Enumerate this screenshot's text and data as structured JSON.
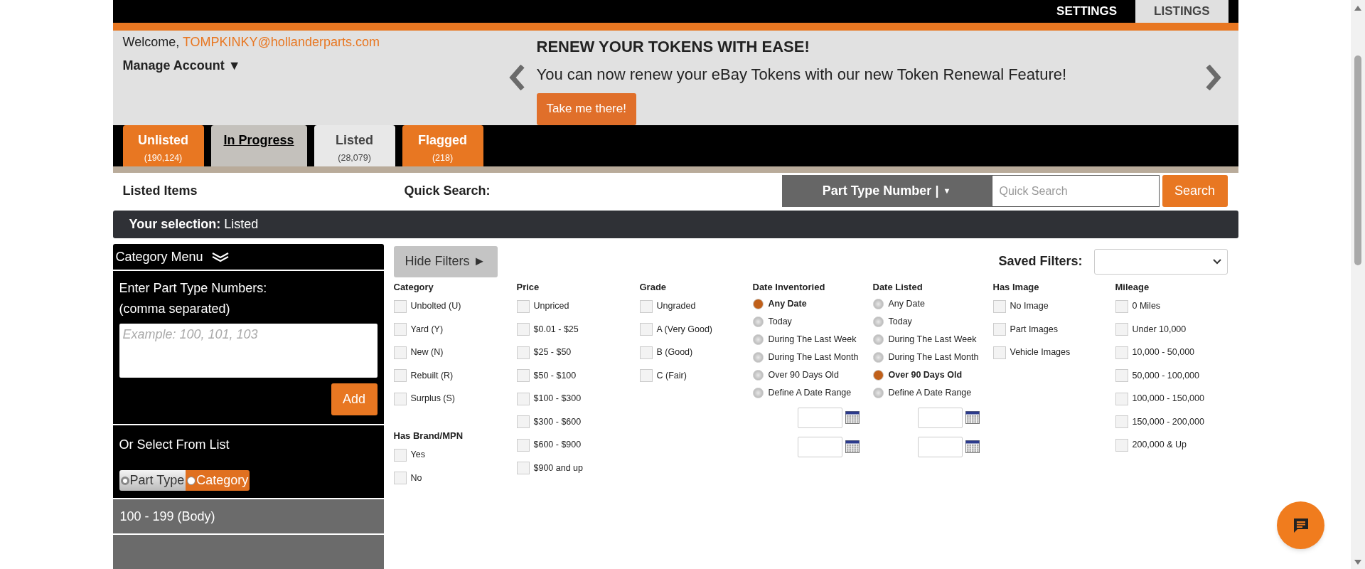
{
  "top_nav": [
    {
      "label": "SETTINGS",
      "selected": false
    },
    {
      "label": "LISTINGS",
      "selected": true
    }
  ],
  "account": {
    "welcome": "Welcome,",
    "email": "TOMPKINKY@hollanderparts.com",
    "manage": "Manage Account ▼"
  },
  "banner": {
    "title": "RENEW YOUR TOKENS WITH EASE!",
    "text": "You can now renew your eBay Tokens with our new Token Renewal Feature!",
    "button": "Take me there!"
  },
  "tabs": [
    {
      "label": "Unlisted",
      "count": "(190,124)",
      "selected": false,
      "hovered": false
    },
    {
      "label": "In Progress",
      "selected": false,
      "hovered": true
    },
    {
      "label": "Listed",
      "count": "(28,079)",
      "selected": true,
      "hovered": false
    },
    {
      "label": "Flagged",
      "count": "(218)",
      "selected": false,
      "hovered": false
    }
  ],
  "search_row": {
    "title": "Listed Items",
    "quick_label": "Quick Search:",
    "dropdown": "Part Type Number |",
    "dropdown_caret": "▼",
    "placeholder": "Quick Search",
    "button": "Search"
  },
  "selection": {
    "label": "Your selection:",
    "value": "Listed"
  },
  "sidebar": {
    "header": "Category Menu",
    "enter_label": "Enter Part Type Numbers:",
    "enter_hint": "(comma separated)",
    "placeholder": "Example: 100, 101, 103",
    "add": "Add",
    "or_label": "Or Select From List",
    "toggle": [
      {
        "label": "Part Type",
        "selected": true
      },
      {
        "label": "Category",
        "selected": false
      }
    ],
    "items": [
      "100 - 199 (Body)"
    ]
  },
  "filters": {
    "hide_button": "Hide Filters ►",
    "saved_label": "Saved Filters:",
    "columns": [
      {
        "groups": [
          {
            "title": "Category",
            "kind": "checkbox",
            "options": [
              {
                "label": "Unbolted (U)",
                "checked": false
              },
              {
                "label": "Yard (Y)",
                "checked": false
              },
              {
                "label": "New (N)",
                "checked": false
              },
              {
                "label": "Rebuilt (R)",
                "checked": false
              },
              {
                "label": "Surplus (S)",
                "checked": false
              }
            ]
          },
          {
            "title": "Has Brand/MPN",
            "kind": "checkbox",
            "options": [
              {
                "label": "Yes",
                "checked": false
              },
              {
                "label": "No",
                "checked": false
              }
            ]
          }
        ]
      },
      {
        "groups": [
          {
            "title": "Price",
            "kind": "checkbox",
            "options": [
              {
                "label": "Unpriced",
                "checked": false
              },
              {
                "label": "$0.01 - $25",
                "checked": false
              },
              {
                "label": "$25 - $50",
                "checked": false
              },
              {
                "label": "$50 - $100",
                "checked": false
              },
              {
                "label": "$100 - $300",
                "checked": false
              },
              {
                "label": "$300 - $600",
                "checked": false
              },
              {
                "label": "$600 - $900",
                "checked": false
              },
              {
                "label": "$900 and up",
                "checked": false
              }
            ]
          }
        ]
      },
      {
        "groups": [
          {
            "title": "Grade",
            "kind": "checkbox",
            "options": [
              {
                "label": "Ungraded",
                "checked": false
              },
              {
                "label": "A (Very Good)",
                "checked": false
              },
              {
                "label": "B (Good)",
                "checked": false
              },
              {
                "label": "C (Fair)",
                "checked": false
              }
            ]
          }
        ]
      },
      {
        "groups": [
          {
            "title": "Date Inventoried",
            "kind": "radio",
            "date_range": true,
            "options": [
              {
                "label": "Any Date",
                "selected": true
              },
              {
                "label": "Today",
                "selected": false
              },
              {
                "label": "During The Last Week",
                "selected": false
              },
              {
                "label": "During The Last Month",
                "selected": false
              },
              {
                "label": "Over 90 Days Old",
                "selected": false
              },
              {
                "label": "Define A Date Range",
                "selected": false
              }
            ]
          }
        ]
      },
      {
        "groups": [
          {
            "title": "Date Listed",
            "kind": "radio",
            "date_range": true,
            "options": [
              {
                "label": "Any Date",
                "selected": false
              },
              {
                "label": "Today",
                "selected": false
              },
              {
                "label": "During The Last Week",
                "selected": false
              },
              {
                "label": "During The Last Month",
                "selected": false
              },
              {
                "label": "Over 90 Days Old",
                "selected": true
              },
              {
                "label": "Define A Date Range",
                "selected": false
              }
            ]
          }
        ]
      },
      {
        "groups": [
          {
            "title": "Has Image",
            "kind": "checkbox",
            "options": [
              {
                "label": "No Image",
                "checked": false
              },
              {
                "label": "Part Images",
                "checked": false
              },
              {
                "label": "Vehicle Images",
                "checked": false
              }
            ]
          }
        ]
      },
      {
        "groups": [
          {
            "title": "Mileage",
            "kind": "checkbox",
            "options": [
              {
                "label": "0 Miles",
                "checked": false
              },
              {
                "label": "Under 10,000",
                "checked": false
              },
              {
                "label": "10,000 - 50,000",
                "checked": false
              },
              {
                "label": "50,000 - 100,000",
                "checked": false
              },
              {
                "label": "100,000 - 150,000",
                "checked": false
              },
              {
                "label": "150,000 - 200,000",
                "checked": false
              },
              {
                "label": "200,000 & Up",
                "checked": false
              }
            ]
          }
        ]
      }
    ]
  }
}
